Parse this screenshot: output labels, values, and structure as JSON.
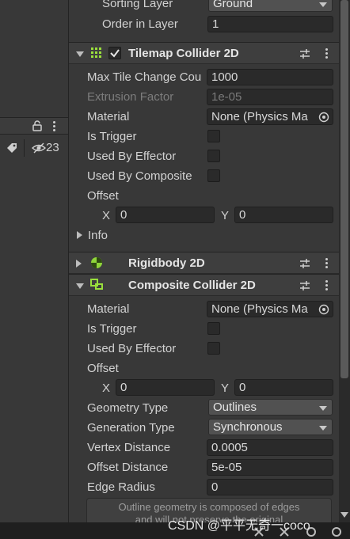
{
  "left_panel": {
    "hidden_count": "23"
  },
  "renderer": {
    "sorting_layer": {
      "label": "Sorting Layer",
      "value": "Ground"
    },
    "order_in_layer": {
      "label": "Order in Layer",
      "value": "1"
    }
  },
  "tilemap_collider": {
    "title": "Tilemap Collider 2D",
    "fields": {
      "max_tile_change": {
        "label": "Max Tile Change Cou",
        "value": "1000"
      },
      "extrusion_factor": {
        "label": "Extrusion Factor",
        "value": "1e-05"
      },
      "material": {
        "label": "Material",
        "value": "None (Physics Ma"
      },
      "is_trigger": {
        "label": "Is Trigger"
      },
      "used_by_effector": {
        "label": "Used By Effector"
      },
      "used_by_composite": {
        "label": "Used By Composite"
      },
      "offset": {
        "label": "Offset",
        "x_label": "X",
        "x": "0",
        "y_label": "Y",
        "y": "0"
      }
    },
    "info_label": "Info"
  },
  "rigidbody": {
    "title": "Rigidbody 2D"
  },
  "composite_collider": {
    "title": "Composite Collider 2D",
    "fields": {
      "material": {
        "label": "Material",
        "value": "None (Physics Ma"
      },
      "is_trigger": {
        "label": "Is Trigger"
      },
      "used_by_effector": {
        "label": "Used By Effector"
      },
      "offset": {
        "label": "Offset",
        "x_label": "X",
        "x": "0",
        "y_label": "Y",
        "y": "0"
      },
      "geometry_type": {
        "label": "Geometry Type",
        "value": "Outlines"
      },
      "generation_type": {
        "label": "Generation Type",
        "value": "Synchronous"
      },
      "vertex_distance": {
        "label": "Vertex Distance",
        "value": "0.0005"
      },
      "offset_distance": {
        "label": "Offset Distance",
        "value": "5e-05"
      },
      "edge_radius": {
        "label": "Edge Radius",
        "value": "0"
      }
    },
    "help_text_1": "Outline geometry is composed of edges",
    "help_text_2": "and will not preserve the original"
  },
  "watermark": "CSDN @平平无奇一coco",
  "colors": {
    "tilemap_icon": "#9ae03c",
    "rigidbody_icon": "#8fd43a",
    "composite_icon": "#9ae03c",
    "panel_bg": "#383838",
    "field_bg": "#2a2a2a"
  }
}
